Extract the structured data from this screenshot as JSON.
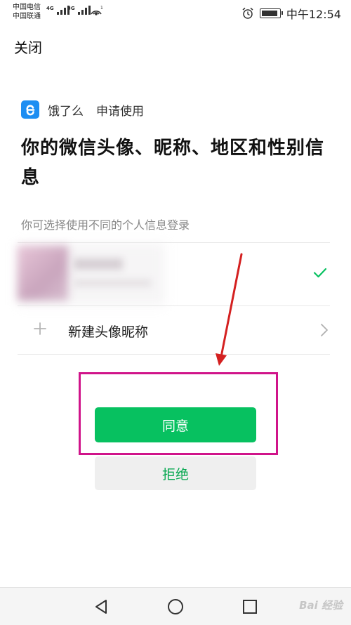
{
  "status_bar": {
    "carrier_1": "中国电信",
    "carrier_2": "中国联通",
    "net_1": "4G",
    "net_2": "3G",
    "time": "中午12:54"
  },
  "header": {
    "close_label": "关闭"
  },
  "app": {
    "name": "饿了么",
    "request": "申请使用",
    "logo_letter": "e",
    "brand_color": "#1d8ef2"
  },
  "auth": {
    "title": "你的微信头像、昵称、地区和性别信息",
    "hint": "你可选择使用不同的个人信息登录"
  },
  "profiles": {
    "selected_icon": "check-icon",
    "new_label": "新建头像昵称"
  },
  "actions": {
    "agree": "同意",
    "reject": "拒绝",
    "agree_color": "#07c160"
  },
  "annotation": {
    "highlight_color": "#d0148a",
    "arrow_color": "#d42020"
  },
  "watermark": "Bai 经验"
}
